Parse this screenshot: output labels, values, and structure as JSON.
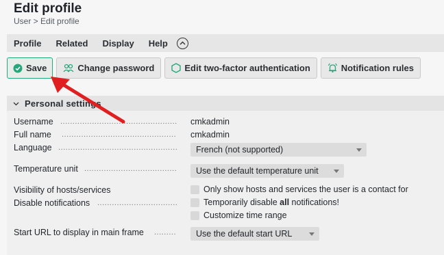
{
  "page": {
    "title": "Edit profile",
    "breadcrumb": "User > Edit profile"
  },
  "menu": {
    "items": [
      "Profile",
      "Related",
      "Display",
      "Help"
    ],
    "toggle_icon": "chevron-up-circle-icon"
  },
  "toolbar": {
    "save": "Save",
    "change_password": "Change password",
    "two_factor": "Edit two-factor authentication",
    "notification_rules": "Notification rules"
  },
  "section": {
    "title": "Personal settings"
  },
  "form": {
    "username": {
      "label": "Username",
      "value": "cmkadmin"
    },
    "full_name": {
      "label": "Full name",
      "value": "cmkadmin"
    },
    "language": {
      "label": "Language",
      "value": "French (not supported)"
    },
    "temperature": {
      "label": "Temperature unit",
      "value": "Use the default temperature unit"
    },
    "visibility": {
      "label": "Visibility of hosts/services",
      "option": "Only show hosts and services the user is a contact for"
    },
    "disable_notifications": {
      "label": "Disable notifications",
      "option_prefix": "Temporarily disable ",
      "option_bold": "all",
      "option_suffix": " notifications!",
      "option2": "Customize time range"
    },
    "start_url": {
      "label": "Start URL to display in main frame",
      "value": "Use the default start URL"
    }
  },
  "colors": {
    "accent": "#26a77b",
    "annotation_arrow": "#e02020"
  }
}
